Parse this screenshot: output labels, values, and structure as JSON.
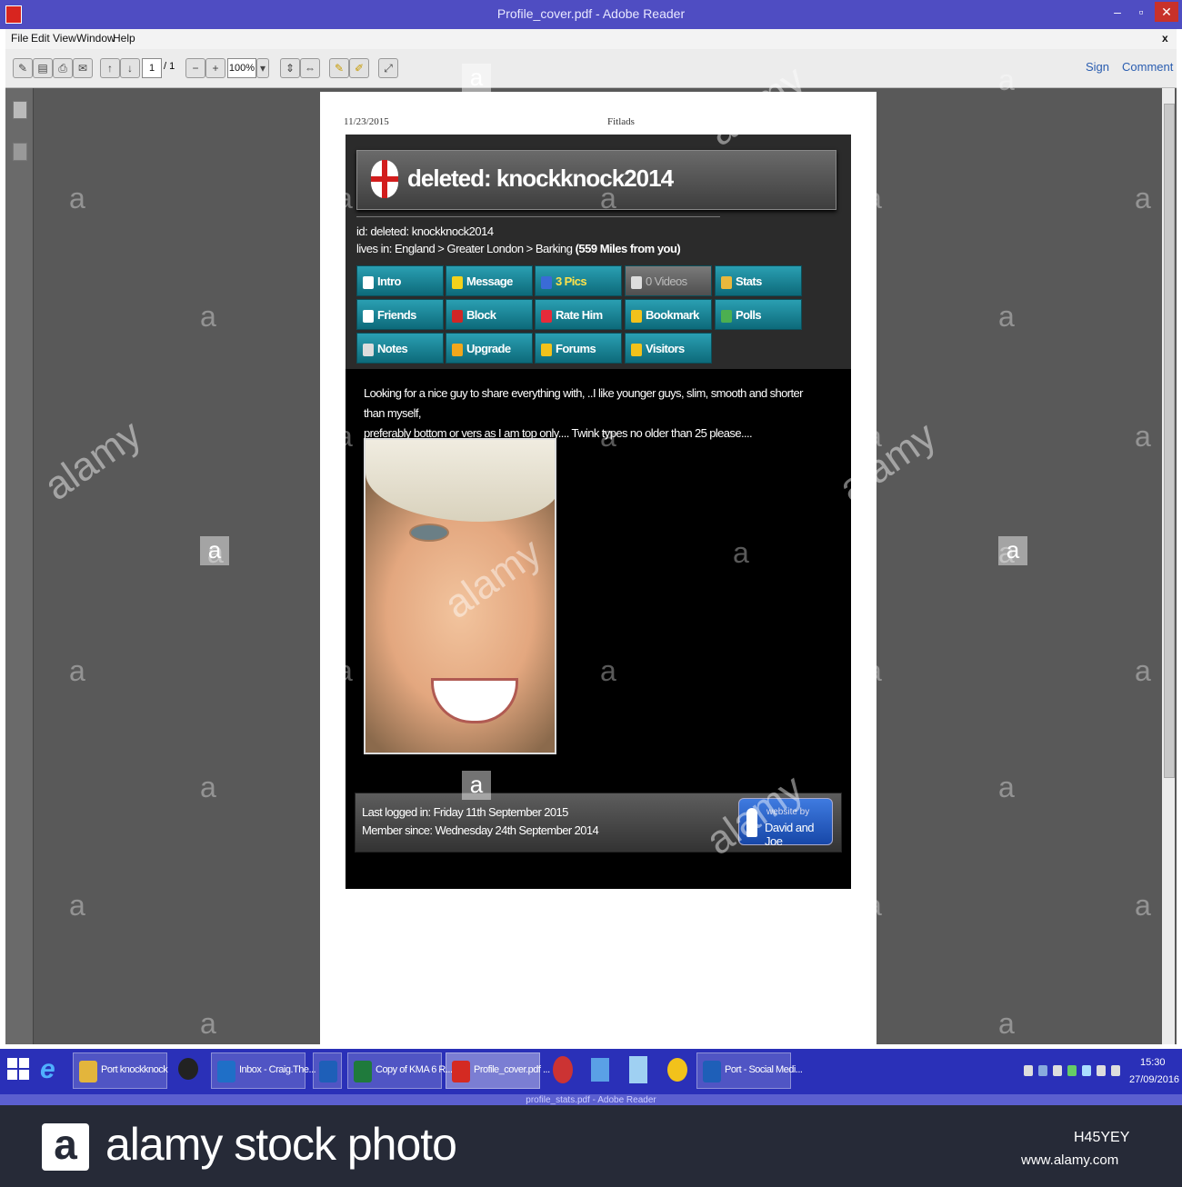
{
  "window": {
    "title": "Profile_cover.pdf - Adobe Reader",
    "minimize_label": "–",
    "maximize_label": "▫",
    "close_label": "✕"
  },
  "menu": {
    "items": [
      "File",
      "Edit",
      "View",
      "Window",
      "Help"
    ],
    "close_doc_label": "x"
  },
  "toolbar": {
    "page_current": "1",
    "page_total": "/ 1",
    "zoom": "100%",
    "sign_label": "Sign",
    "comment_label": "Comment"
  },
  "pdf_page": {
    "header_date": "11/23/2015",
    "header_title": "Fitlads"
  },
  "profile": {
    "name": "deleted: knockknock2014",
    "id_line": "id: deleted: knockknock2014",
    "lives_prefix": "lives in: England > Greater London > Barking ",
    "lives_distance": "(559 Miles from you)",
    "nav_buttons": [
      {
        "label": "Intro",
        "icon_color": "#ffffff",
        "disabled": false
      },
      {
        "label": "Message",
        "icon_color": "#f4d21b",
        "disabled": false
      },
      {
        "label": "3 Pics",
        "icon_color": "#3a6bd6",
        "disabled": false
      },
      {
        "label": "0 Videos",
        "icon_color": "#dddddd",
        "disabled": true
      },
      {
        "label": "Stats",
        "icon_color": "#e9b83c",
        "disabled": false
      },
      {
        "label": "Friends",
        "icon_color": "#ffffff",
        "disabled": false
      },
      {
        "label": "Block",
        "icon_color": "#d02626",
        "disabled": false
      },
      {
        "label": "Rate Him",
        "icon_color": "#e52b3a",
        "disabled": false
      },
      {
        "label": "Bookmark",
        "icon_color": "#f2c21b",
        "disabled": false
      },
      {
        "label": "Polls",
        "icon_color": "#4caf50",
        "disabled": false
      },
      {
        "label": "Notes",
        "icon_color": "#dddddd",
        "disabled": false
      },
      {
        "label": "Upgrade",
        "icon_color": "#f2a71b",
        "disabled": false
      },
      {
        "label": "Forums",
        "icon_color": "#f2c21b",
        "disabled": false
      },
      {
        "label": "Visitors",
        "icon_color": "#f2c21b",
        "disabled": false
      }
    ],
    "bio_line1": "Looking for a nice guy to share everything with, ..I like younger guys, slim, smooth and shorter than myself,",
    "bio_line2": "preferably bottom or vers as I am top only.... Twink types no older than 25 please....",
    "last_logged": "Last logged in: Friday 11th September 2015",
    "member_since": "Member since: Wednesday 24th September 2014",
    "website_by_line1": "website by",
    "website_by_line2": "David and Joe"
  },
  "taskbar": {
    "items": [
      {
        "label": "Port knockknock",
        "icon_color": "#e3b53c",
        "active": false
      },
      {
        "label": "Inbox - Craig.The...",
        "icon_color": "#1f6fc7",
        "active": false
      },
      {
        "label": "",
        "icon_color": "#1e5fb8",
        "active": false
      },
      {
        "label": "Copy of KMA 6 R...",
        "icon_color": "#1f7a3c",
        "active": false
      },
      {
        "label": "Profile_cover.pdf ...",
        "icon_color": "#d42a22",
        "active": true
      },
      {
        "label": "Port - Social Medi...",
        "icon_color": "#1e5fb8",
        "active": false
      }
    ],
    "clock_time": "15:30",
    "clock_date": "27/09/2016"
  },
  "strip_text": "profile_stats.pdf - Adobe Reader",
  "watermark": {
    "letter": "a",
    "word": "alamy"
  },
  "banner": {
    "logo_letter": "a",
    "title": "alamy stock photo",
    "image_code": "H45YEY",
    "url": "www.alamy.com"
  }
}
